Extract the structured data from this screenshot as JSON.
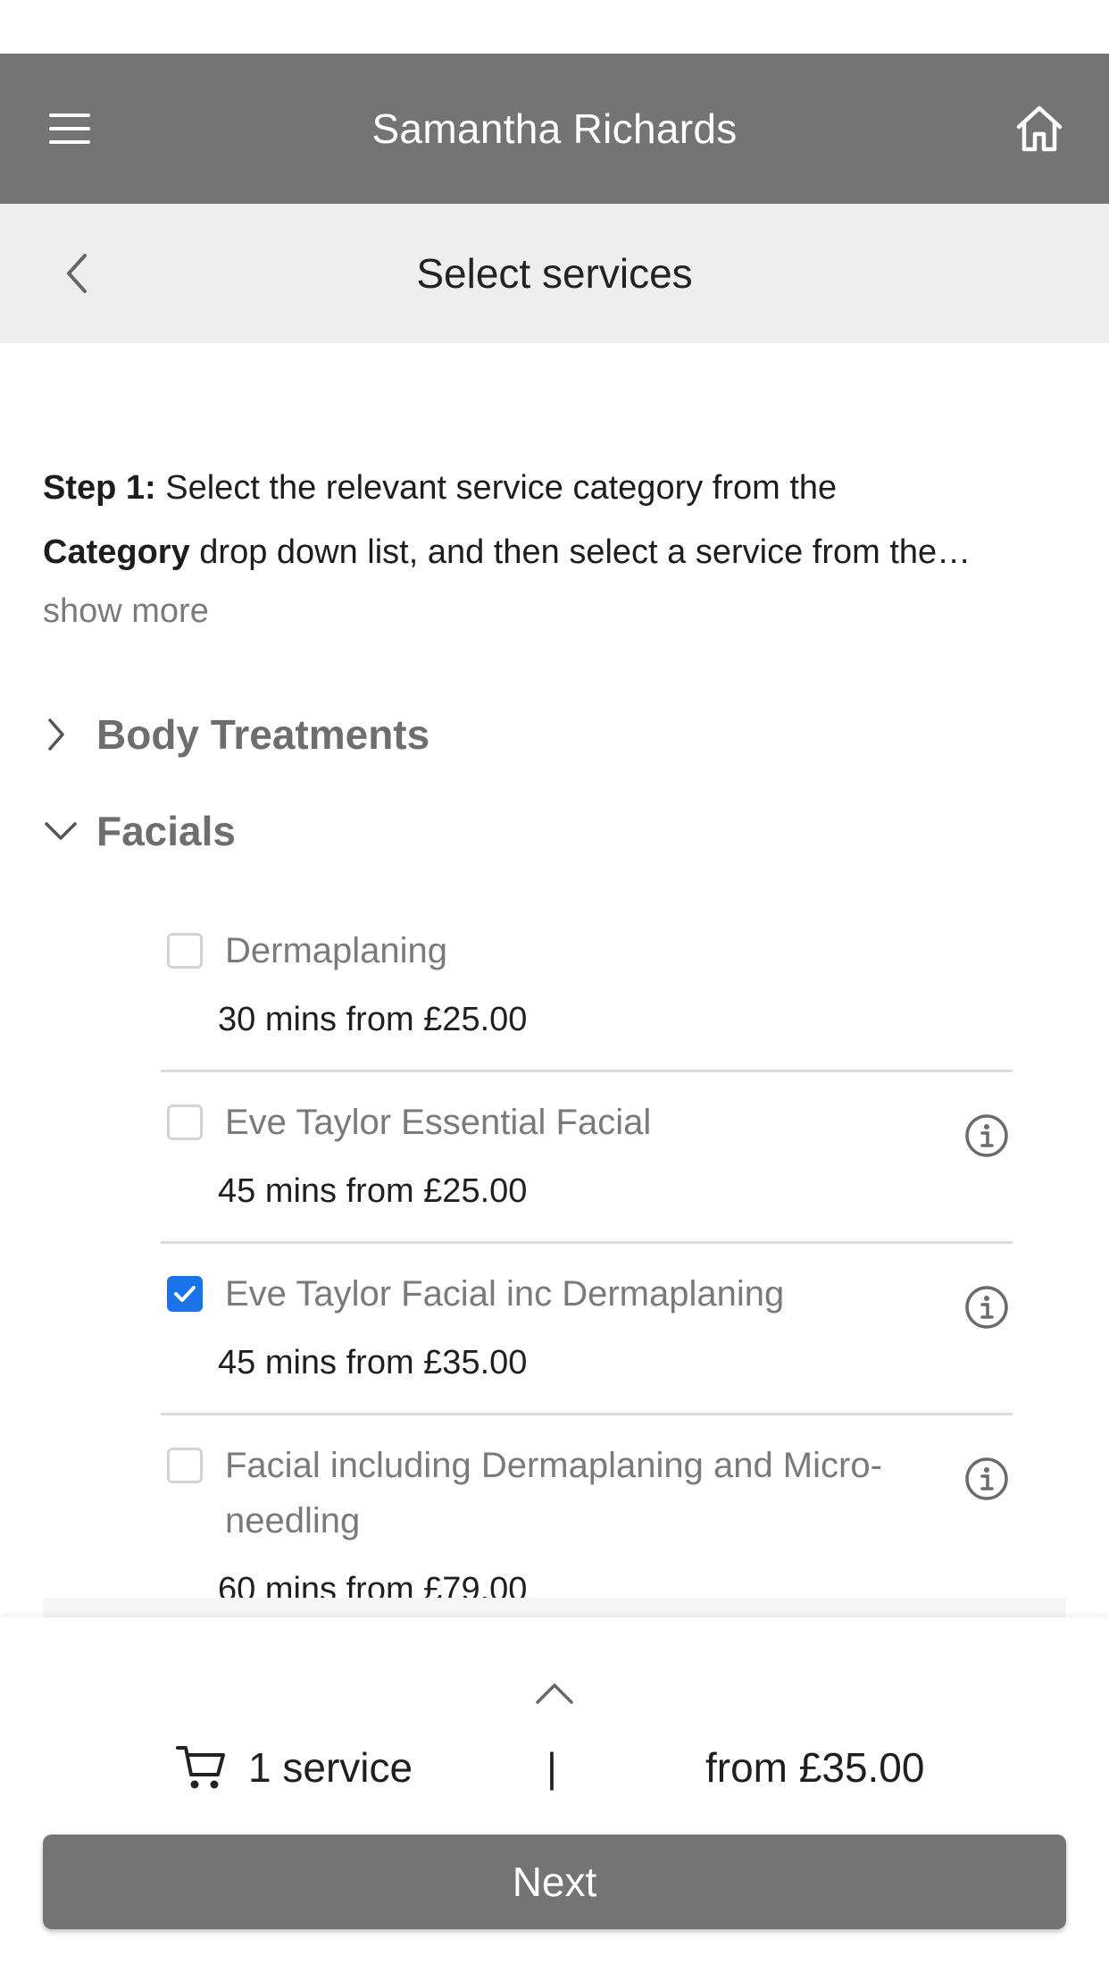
{
  "header": {
    "title": "Samantha Richards",
    "menu_icon": "hamburger-menu-icon",
    "home_icon": "home-icon"
  },
  "subheader": {
    "title": "Select services",
    "back_icon": "chevron-left-icon"
  },
  "intro": {
    "step_label": "Step 1:",
    "line1_rest": " Select the relevant service category from the",
    "category_word": "Category",
    "line2_rest": " drop down list, and then select a service from the…",
    "show_more": "show more"
  },
  "categories": [
    {
      "label": "Body Treatments",
      "expanded": false
    },
    {
      "label": "Facials",
      "expanded": true
    }
  ],
  "services": [
    {
      "name": "Dermaplaning",
      "meta": "30 mins from £25.00",
      "checked": false,
      "has_info": false
    },
    {
      "name": "Eve Taylor Essential Facial",
      "meta": "45 mins from £25.00",
      "checked": false,
      "has_info": true
    },
    {
      "name": "Eve Taylor Facial inc Dermaplaning",
      "meta": "45 mins from £35.00",
      "checked": true,
      "has_info": true
    },
    {
      "name_line1": "Facial including Dermaplaning and Micro-",
      "name_line2": "needling",
      "meta": "60 mins from £79.00",
      "checked": false,
      "has_info": true
    }
  ],
  "footer": {
    "cart_count": "1 service",
    "separator": "|",
    "total": "from £35.00",
    "next_label": "Next"
  },
  "colors": {
    "appbar": "#747474",
    "subbar": "#eeeeee",
    "accent": "#1a73e8"
  }
}
